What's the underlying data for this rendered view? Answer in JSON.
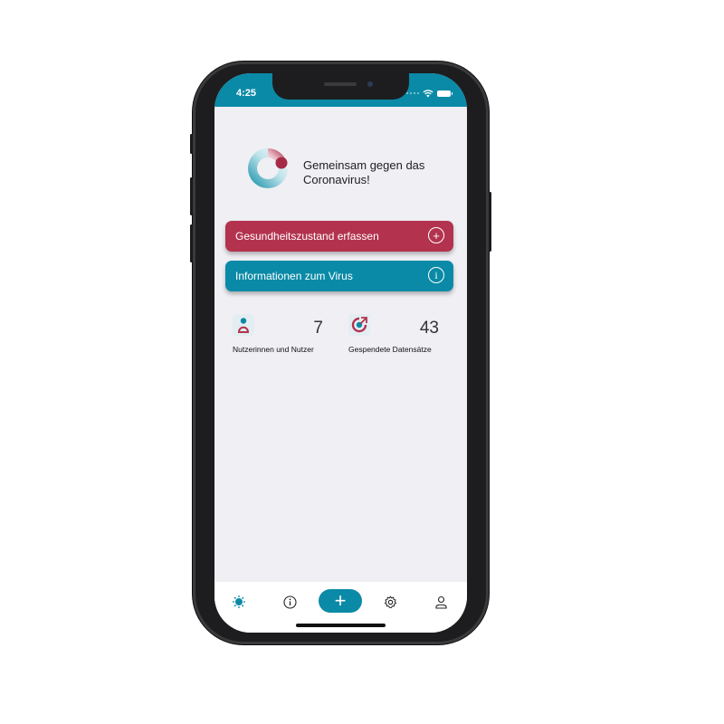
{
  "status_bar": {
    "time": "4:25"
  },
  "hero": {
    "tagline": "Gemeinsam gegen das Coronavirus!"
  },
  "actions": {
    "report_health": {
      "label": "Gesundheitszustand erfassen",
      "icon": "plus-circle-icon"
    },
    "virus_info": {
      "label": "Informationen zum Virus",
      "icon": "info-circle-icon"
    }
  },
  "stats": {
    "users": {
      "value": "7",
      "label": "Nutzerinnen und Nutzer",
      "icon": "person-icon"
    },
    "datasets": {
      "value": "43",
      "label": "Gespendete Datensätze",
      "icon": "donate-data-icon"
    }
  },
  "tabbar": {
    "items": [
      {
        "icon": "virus-icon",
        "active": true
      },
      {
        "icon": "info-icon",
        "active": false
      },
      {
        "icon": "plus-icon",
        "label": "+",
        "active": false
      },
      {
        "icon": "gear-icon",
        "active": false
      },
      {
        "icon": "person-icon",
        "active": false
      }
    ]
  },
  "colors": {
    "accent_teal": "#0a8aa6",
    "accent_red": "#b3334e",
    "background": "#efeff4"
  }
}
